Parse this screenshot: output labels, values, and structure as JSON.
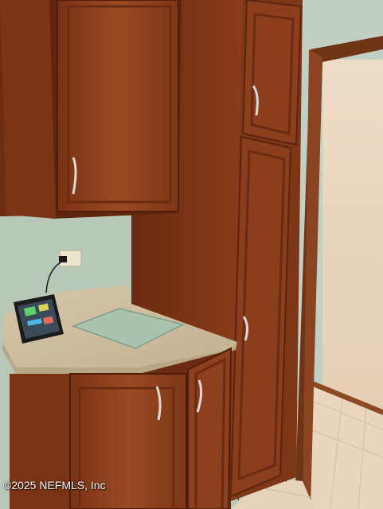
{
  "photo": {
    "subject": "kitchen-corner-cabinets",
    "colors": {
      "wall": "#b7c7b8",
      "cabinet_wood": "#8e3f1c",
      "cabinet_dark": "#5e260f",
      "countertop": "#cdbca0",
      "door_frame": "#6f3416",
      "hallway_wall": "#e6d2b8",
      "floor_tile": "#e9d6be"
    }
  },
  "watermark": {
    "text": "©2025 NEFMLS, Inc"
  }
}
